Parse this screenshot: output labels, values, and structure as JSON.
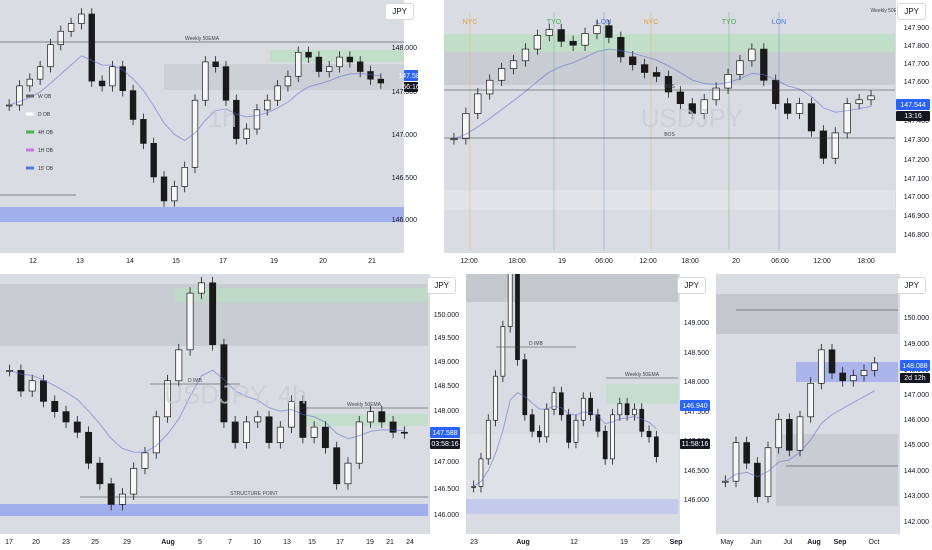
{
  "symbol": "JPY",
  "colors": {
    "bg": "#d9dce3",
    "candle_body": "#f7f7f7",
    "candle_stroke": "#1a1a1a",
    "green_zone": "#b9dfc0",
    "blue_zone": "#3b5cff",
    "gray_zone": "#b4b7be",
    "price_tag": "#2962ff",
    "timer_tag": "#131722"
  },
  "panels": [
    {
      "id": "p1",
      "x_ticks": [
        "12",
        "13",
        "14",
        "15",
        "17",
        "19",
        "20",
        "21"
      ],
      "y_ticks": [
        "148.000",
        "147.500",
        "147.000",
        "146.500",
        "146.000"
      ],
      "price_tag": "147.582",
      "timer_tag": "56:16",
      "legend": [
        "W OB",
        "D OB",
        "4H OB",
        "1H OB",
        "15' OB"
      ],
      "line_labels": [
        "Weekly 50EMA"
      ],
      "watermark": "1h"
    },
    {
      "id": "p2",
      "x_ticks": [
        "12:00",
        "18:00",
        "19",
        "06:00",
        "12:00",
        "18:00",
        "20",
        "06:00",
        "12:00",
        "18:00"
      ],
      "y_ticks": [
        "147.900",
        "147.800",
        "147.700",
        "147.600",
        "147.500",
        "147.400",
        "147.300",
        "147.200",
        "147.100",
        "147.000",
        "146.900",
        "146.800"
      ],
      "price_tag": "147.544",
      "timer_tag": "13:16",
      "session_labels": [
        "NYC",
        "TYO",
        "LON",
        "NYC",
        "TYO",
        "LON"
      ],
      "line_labels": [
        "Weekly 50EMA",
        "BOS",
        "BOS"
      ],
      "watermark": "USDJPY"
    },
    {
      "id": "p3",
      "x_ticks": [
        "17",
        "20",
        "23",
        "25",
        "29",
        "Aug",
        "5",
        "7",
        "10",
        "13",
        "15",
        "17",
        "19",
        "21",
        "24"
      ],
      "y_ticks": [
        "150.000",
        "149.500",
        "149.000",
        "148.500",
        "148.000",
        "147.500",
        "147.000",
        "146.500",
        "146.000"
      ],
      "price_tag": "147.588",
      "timer_tag": "03:58:16",
      "line_labels": [
        "Weekly 50EMA",
        "STRUCTURE POINT",
        "D IMB"
      ],
      "watermark": "USDJPY, 4h"
    },
    {
      "id": "p4",
      "x_ticks": [
        "23",
        "Aug",
        "12",
        "19",
        "25",
        "Sep"
      ],
      "y_ticks": [
        "149.000",
        "148.500",
        "148.000",
        "147.500",
        "147.000",
        "146.500",
        "146.000"
      ],
      "price_tag": "146.940",
      "timer_tag": "11:58:16",
      "line_labels": [
        "Weekly 50EMA",
        "D IMB"
      ]
    },
    {
      "id": "p5",
      "x_ticks": [
        "May",
        "Jun",
        "Jul",
        "Aug",
        "Sep",
        "Oct"
      ],
      "y_ticks": [
        "150.000",
        "149.000",
        "148.000",
        "147.000",
        "146.000",
        "145.000",
        "144.000",
        "143.000",
        "142.000"
      ],
      "price_tag": "148.088",
      "timer_tag": "2d 12h"
    }
  ],
  "chart_data": [
    {
      "type": "candlestick",
      "panel": "USDJPY 1h",
      "ylim": [
        145.9,
        148.3
      ],
      "x_ticks": [
        "12",
        "13",
        "14",
        "15",
        "17",
        "19",
        "20",
        "21"
      ],
      "close": [
        147.35,
        147.55,
        147.62,
        147.75,
        147.98,
        148.12,
        148.2,
        148.3,
        147.6,
        147.55,
        147.75,
        147.5,
        147.2,
        146.95,
        146.6,
        146.35,
        146.5,
        146.7,
        147.4,
        147.8,
        147.75,
        147.4,
        147.0,
        147.1,
        147.3,
        147.4,
        147.55,
        147.65,
        147.9,
        147.85,
        147.7,
        147.75,
        147.85,
        147.8,
        147.7,
        147.62,
        147.58
      ],
      "current_price": 147.582
    },
    {
      "type": "candlestick",
      "panel": "USDJPY 15m",
      "ylim": [
        146.78,
        147.96
      ],
      "x_ticks": [
        "12:00",
        "18:00",
        "19",
        "06:00",
        "12:00",
        "18:00",
        "20",
        "06:00",
        "12:00",
        "18:00"
      ],
      "close": [
        147.32,
        147.45,
        147.55,
        147.62,
        147.68,
        147.72,
        147.78,
        147.85,
        147.88,
        147.82,
        147.8,
        147.86,
        147.9,
        147.84,
        147.74,
        147.7,
        147.66,
        147.64,
        147.56,
        147.5,
        147.45,
        147.52,
        147.58,
        147.65,
        147.72,
        147.78,
        147.62,
        147.5,
        147.45,
        147.5,
        147.36,
        147.22,
        147.35,
        147.5,
        147.52,
        147.54
      ],
      "current_price": 147.544
    },
    {
      "type": "candlestick",
      "panel": "USDJPY 4h",
      "ylim": [
        145.8,
        150.4
      ],
      "x_ticks": [
        "17",
        "20",
        "23",
        "25",
        "29",
        "Aug",
        "5",
        "7",
        "10",
        "13",
        "15",
        "17",
        "19",
        "21",
        "24"
      ],
      "close": [
        148.8,
        148.4,
        148.6,
        148.2,
        148.0,
        147.8,
        147.6,
        147.0,
        146.6,
        146.2,
        146.4,
        146.9,
        147.2,
        147.9,
        148.6,
        149.2,
        150.3,
        150.5,
        149.3,
        147.8,
        147.4,
        147.8,
        147.9,
        147.4,
        147.7,
        148.2,
        147.5,
        147.7,
        147.3,
        146.6,
        147.0,
        147.8,
        148.0,
        147.8,
        147.6,
        147.59
      ],
      "current_price": 147.588
    },
    {
      "type": "candlestick",
      "panel": "USDJPY 1D",
      "ylim": [
        145.7,
        150.0
      ],
      "x_ticks": [
        "23",
        "Aug",
        "12",
        "19",
        "25",
        "Sep"
      ],
      "close": [
        146.4,
        146.9,
        147.6,
        148.4,
        149.3,
        150.5,
        148.7,
        147.7,
        147.4,
        147.3,
        147.8,
        148.1,
        147.7,
        147.2,
        147.6,
        148.0,
        147.7,
        147.4,
        146.9,
        147.7,
        147.9,
        147.7,
        147.8,
        147.4,
        147.3,
        146.94
      ],
      "current_price": 146.94
    },
    {
      "type": "candlestick",
      "panel": "USDJPY 1W",
      "ylim": [
        141.8,
        151.0
      ],
      "x_ticks": [
        "May",
        "Jun",
        "Jul",
        "Aug",
        "Sep",
        "Oct"
      ],
      "close": [
        143.5,
        145.0,
        144.2,
        142.9,
        144.8,
        145.9,
        144.7,
        146.0,
        147.3,
        148.6,
        147.7,
        147.4,
        147.6,
        147.8,
        148.09
      ],
      "current_price": 148.088
    }
  ]
}
